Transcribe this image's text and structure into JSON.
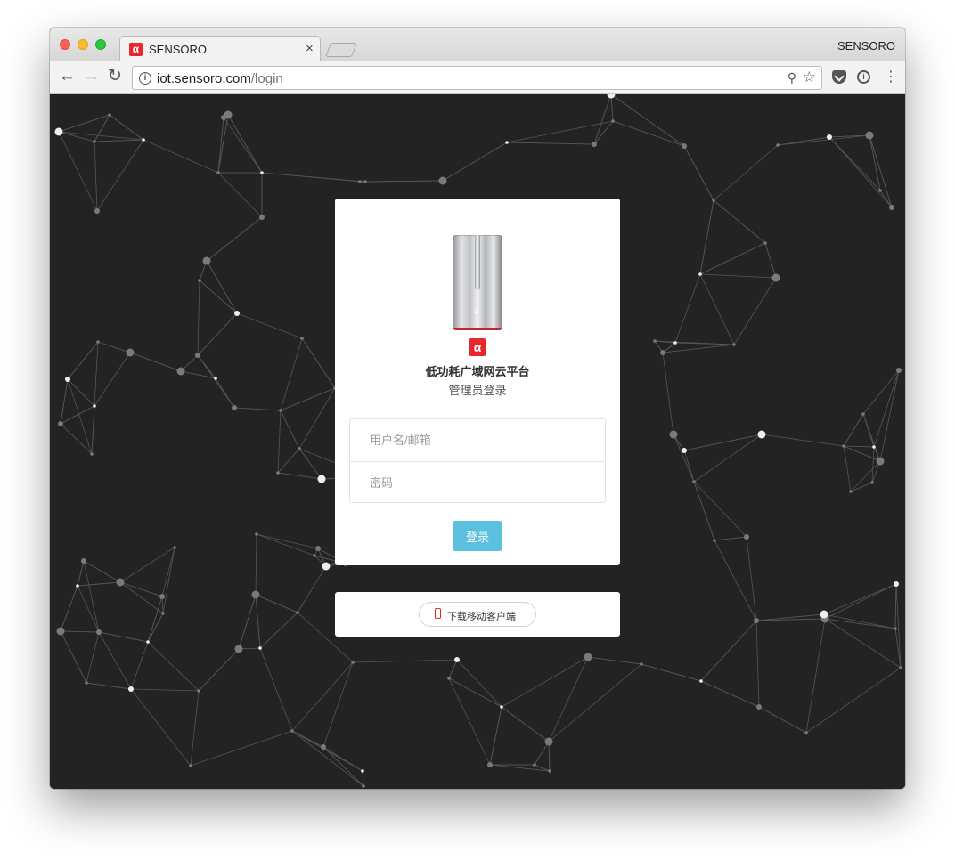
{
  "browser": {
    "tab_title": "SENSORO",
    "tab_favicon_glyph": "α",
    "tab_close_glyph": "×",
    "profile_name": "SENSORO",
    "url_host": "iot.sensoro.com",
    "url_path": "/login",
    "icons": {
      "back": "←",
      "forward": "→",
      "reload": "↻",
      "info": "i",
      "key": "⚲",
      "star": "☆",
      "onepassword": "i",
      "menu": "⋮"
    }
  },
  "login": {
    "brand_glyph": "α",
    "device_logo_glyph": "α",
    "title": "低功耗广域网云平台",
    "subtitle": "管理员登录",
    "username_placeholder": "用户名/邮箱",
    "password_placeholder": "密码",
    "submit_label": "登录"
  },
  "download": {
    "label": "下载移动客户端"
  },
  "colors": {
    "brand_red": "#e8262d",
    "button_blue": "#5bc0de",
    "background": "#232323"
  }
}
